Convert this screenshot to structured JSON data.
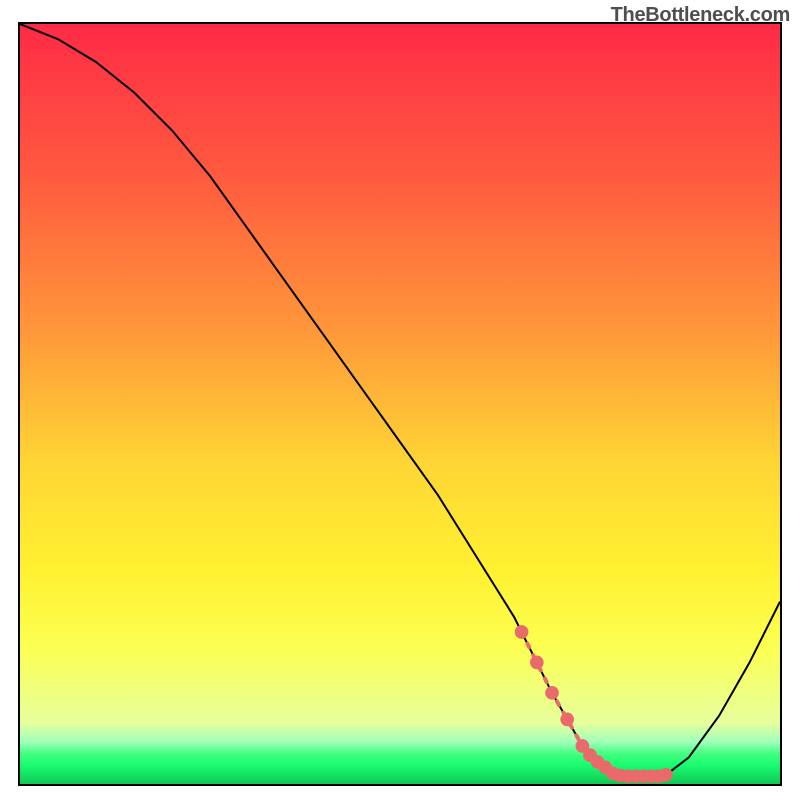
{
  "watermark": "TheBottleneck.com",
  "chart_data": {
    "type": "line",
    "title": "",
    "xlabel": "",
    "ylabel": "",
    "xlim": [
      0,
      100
    ],
    "ylim": [
      0,
      100
    ],
    "series": [
      {
        "name": "bottleneck-curve",
        "x": [
          0,
          5,
          10,
          15,
          20,
          25,
          30,
          35,
          40,
          45,
          50,
          55,
          60,
          65,
          66,
          70,
          74,
          78,
          82,
          84,
          85,
          88,
          92,
          96,
          100
        ],
        "y": [
          100,
          98,
          95,
          91,
          86,
          80,
          73,
          66,
          59,
          52,
          45,
          38,
          30,
          22,
          20,
          12,
          5,
          1.4,
          1.0,
          1.0,
          1.2,
          3.5,
          9,
          16,
          24
        ]
      }
    ],
    "highlight_segment": {
      "name": "optimal-range",
      "x_start": 66,
      "x_end": 85,
      "points_x": [
        66,
        68,
        70,
        72,
        74,
        75,
        76,
        77,
        78,
        79,
        80,
        81,
        82,
        83,
        84,
        85
      ],
      "points_y": [
        20,
        16,
        12,
        8.5,
        5,
        3.8,
        2.9,
        2.2,
        1.4,
        1.1,
        1.0,
        1.0,
        1.0,
        1.0,
        1.0,
        1.2
      ]
    },
    "gradient_stops": [
      {
        "offset": 0,
        "color": "#ff2b46"
      },
      {
        "offset": 20,
        "color": "#ff5a3f"
      },
      {
        "offset": 40,
        "color": "#ff963a"
      },
      {
        "offset": 58,
        "color": "#ffd635"
      },
      {
        "offset": 72,
        "color": "#fff130"
      },
      {
        "offset": 82,
        "color": "#fcff52"
      },
      {
        "offset": 92,
        "color": "#e7ff9e"
      },
      {
        "offset": 94.5,
        "color": "#9dffba"
      },
      {
        "offset": 96,
        "color": "#44ff7f"
      },
      {
        "offset": 97.5,
        "color": "#1afc70"
      },
      {
        "offset": 100,
        "color": "#0fc854"
      }
    ]
  }
}
